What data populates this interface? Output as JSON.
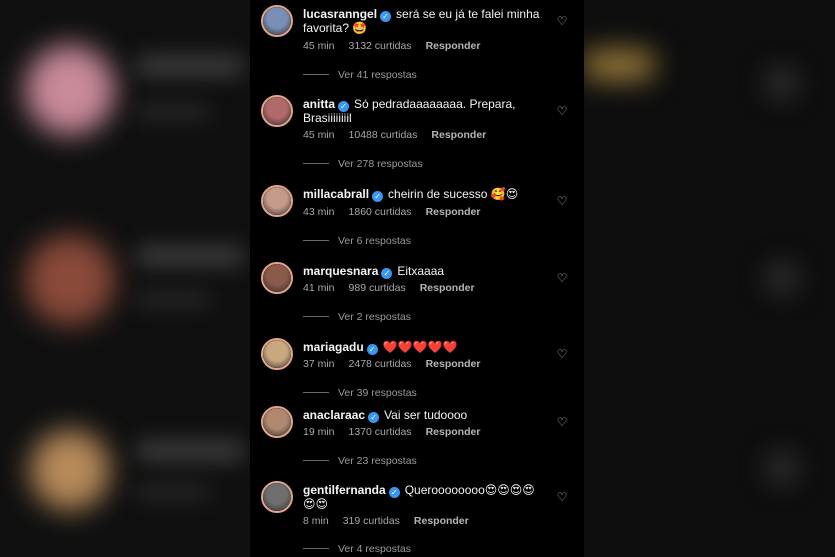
{
  "comments": [
    {
      "username": "lucasranngel",
      "text": "será se eu já te falei minha favorita? 🤩",
      "time": "45 min",
      "likes": "3132 curtidas",
      "reply": "Responder",
      "replies": "Ver 41 respostas",
      "avatar_color": "#7a8fb5"
    },
    {
      "username": "anitta",
      "text": "Só pedradaaaaaaaa. Prepara, Brasiiiiiiiil",
      "time": "45 min",
      "likes": "10488 curtidas",
      "reply": "Responder",
      "replies": "Ver 278 respostas",
      "avatar_color": "#b06a6a"
    },
    {
      "username": "millacabrall",
      "text": "cheirin de sucesso 🥰😍",
      "time": "43 min",
      "likes": "1860 curtidas",
      "reply": "Responder",
      "replies": "Ver 6 respostas",
      "avatar_color": "#c49a8a"
    },
    {
      "username": "marquesnara",
      "text": "Eitxaaaa",
      "time": "41 min",
      "likes": "989 curtidas",
      "reply": "Responder",
      "replies": "Ver 2 respostas",
      "avatar_color": "#8a5a4a"
    },
    {
      "username": "mariagadu",
      "text": "❤️❤️❤️❤️❤️",
      "time": "37 min",
      "likes": "2478 curtidas",
      "reply": "Responder",
      "replies": "Ver 39 respostas",
      "avatar_color": "#c9a880"
    },
    {
      "username": "anaclaraac",
      "text": "Vai ser tudoooo",
      "time": "19 min",
      "likes": "1370 curtidas",
      "reply": "Responder",
      "replies": "Ver 23 respostas",
      "avatar_color": "#b08870"
    },
    {
      "username": "gentilfernanda",
      "text": "Queroooooooo😍😍😍😍😍😍",
      "time": "8 min",
      "likes": "319 curtidas",
      "reply": "Responder",
      "replies": "Ver 4 respostas",
      "avatar_color": "#6e6e6e"
    }
  ],
  "icons": {
    "heart": "heart-icon",
    "verified": "verified-badge-icon"
  }
}
